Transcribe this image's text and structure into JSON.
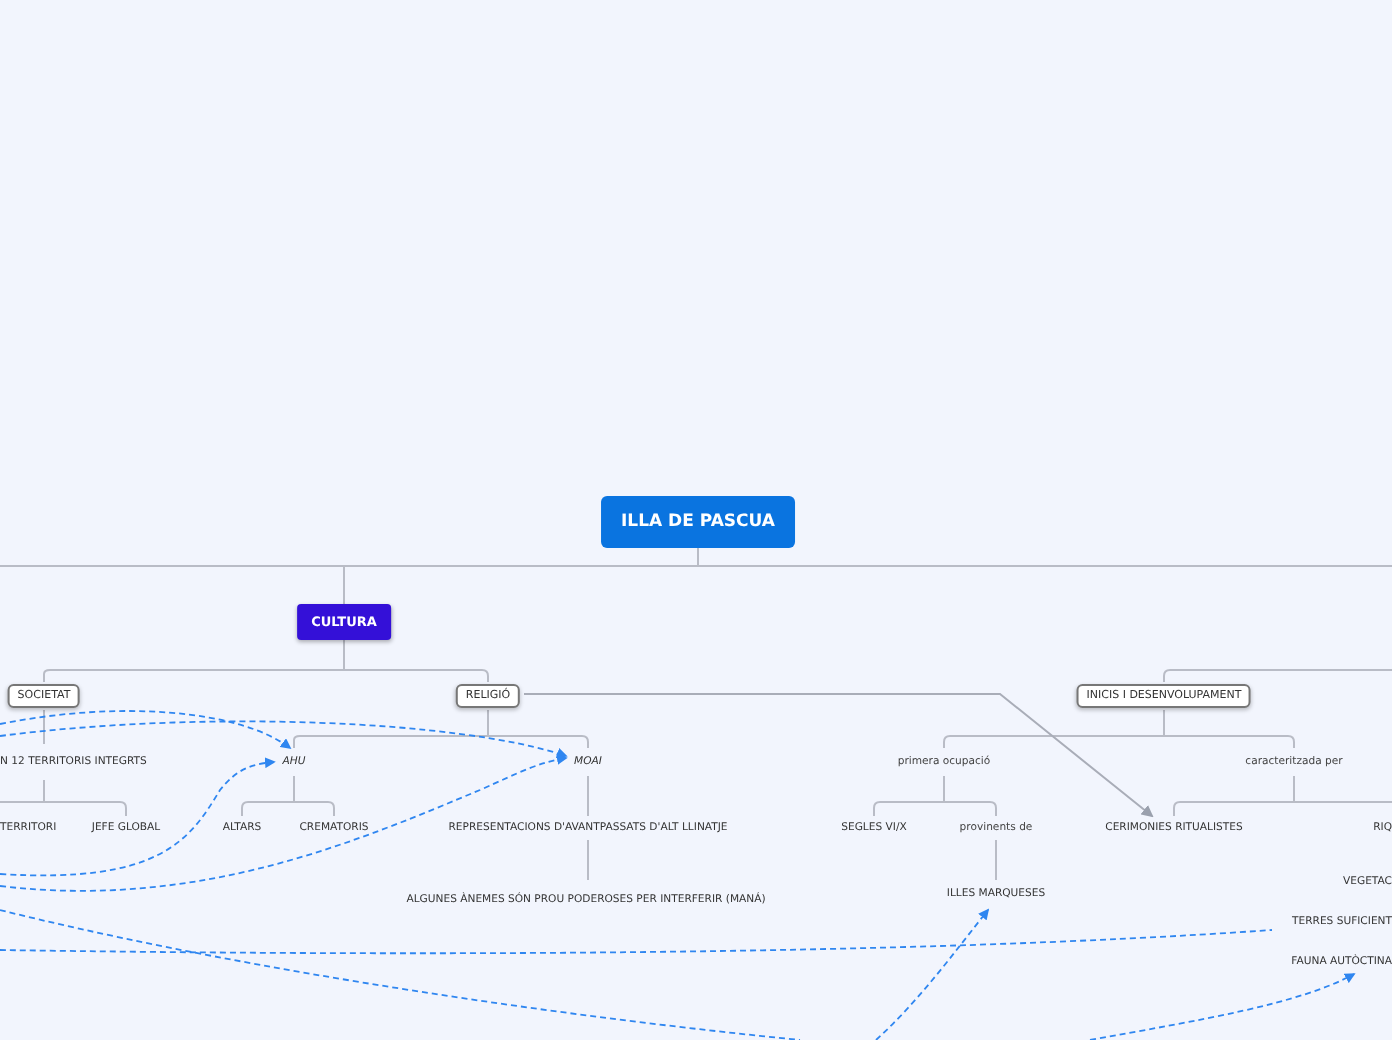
{
  "mind_map": {
    "nodes": [
      {
        "kind": "root",
        "text": "ILLA DE PASCUA"
      },
      {
        "kind": "main",
        "text": "CULTURA"
      },
      {
        "kind": "box",
        "text": "SOCIETAT"
      },
      {
        "kind": "box",
        "text": "RELIGIÓ"
      },
      {
        "kind": "box",
        "text": "INICIS I DESENVOLUPAMENT"
      },
      {
        "kind": "text",
        "text": "N 12 TERRITORIS INTEGRTS"
      },
      {
        "kind": "italic",
        "text": "AHU"
      },
      {
        "kind": "italic",
        "text": "MOAI"
      },
      {
        "kind": "label",
        "text": "primera ocupació"
      },
      {
        "kind": "label",
        "text": "caracteritzada per"
      },
      {
        "kind": "text",
        "text": "TERRITORI"
      },
      {
        "kind": "text",
        "text": "JEFE GLOBAL"
      },
      {
        "kind": "text",
        "text": "ALTARS"
      },
      {
        "kind": "text",
        "text": "CREMATORIS"
      },
      {
        "kind": "text",
        "text": "REPRESENTACIONS D'AVANTPASSATS D'ALT LLINATJE"
      },
      {
        "kind": "text",
        "text": "SEGLES VI/X"
      },
      {
        "kind": "label",
        "text": "provinents de"
      },
      {
        "kind": "text",
        "text": "CERIMONIES RITUALISTES"
      },
      {
        "kind": "text",
        "text": "RIQ"
      },
      {
        "kind": "text",
        "text": "ALGUNES ÀNEMES SÓN PROU PODEROSES PER INTERFERIR (MANÁ)"
      },
      {
        "kind": "text",
        "text": "ILLES MARQUESES"
      },
      {
        "kind": "text",
        "text": "VEGETAC"
      },
      {
        "kind": "text",
        "text": "TERRES SUFICIENT"
      },
      {
        "kind": "text",
        "text": "FAUNA AUTÒCTINA"
      }
    ]
  }
}
